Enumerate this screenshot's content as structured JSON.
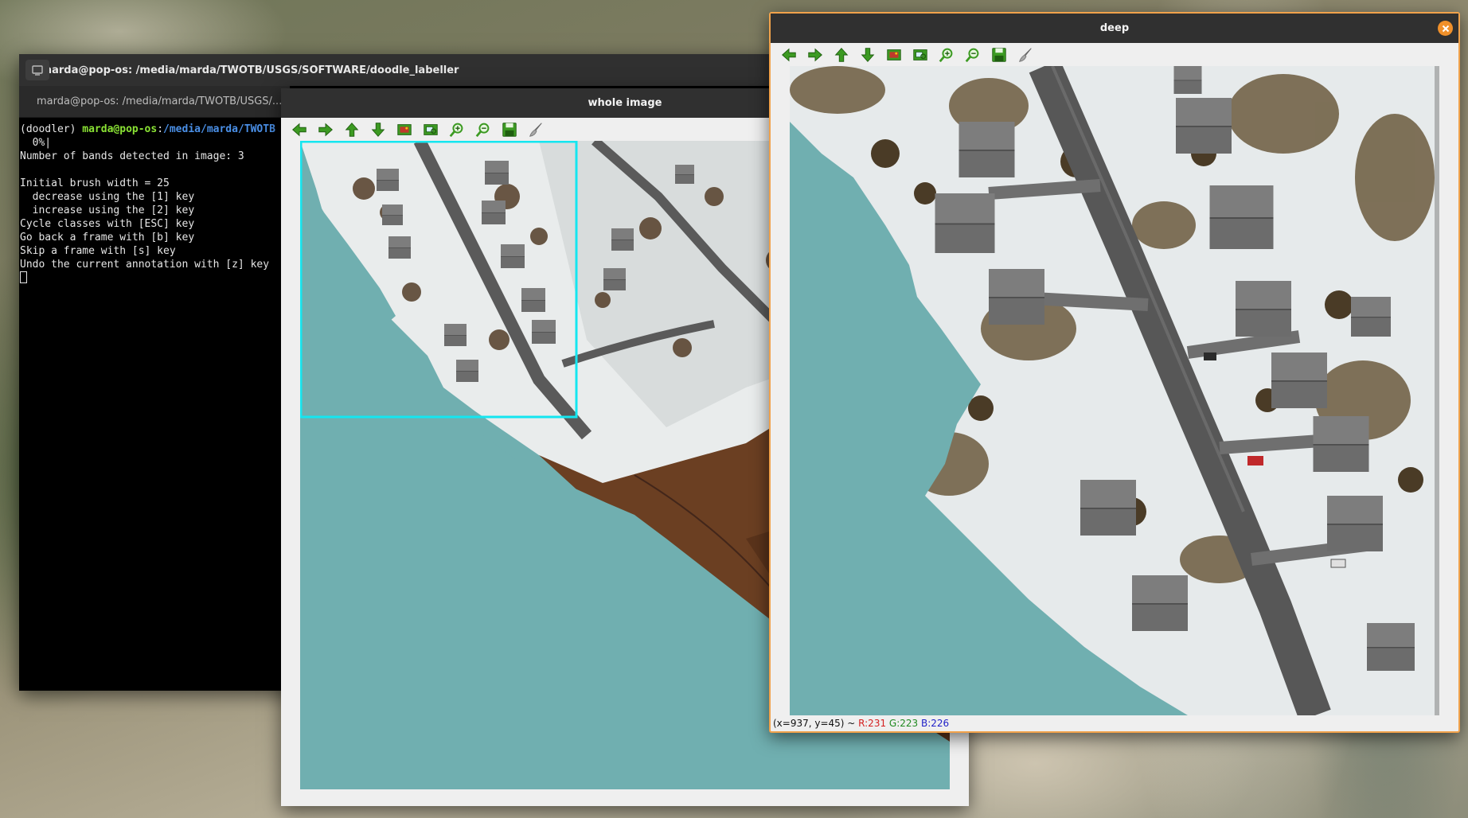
{
  "terminal": {
    "title": "marda@pop-os: /media/marda/TWOTB/USGS/SOFTWARE/doodle_labeller",
    "tab_label": "marda@pop-os: /media/marda/TWOTB/USGS/...",
    "prompt_env": "(doodler) ",
    "prompt_user": "marda@pop-os",
    "prompt_sep": ":",
    "prompt_path": "/media/marda/TWOTB",
    "lines": [
      "  0%|",
      "Number of bands detected in image: 3",
      "",
      "Initial brush width = 25",
      "  decrease using the [1] key",
      "  increase using the [2] key",
      "Cycle classes with [ESC] key",
      "Go back a frame with [b] key",
      "Skip a frame with [s] key",
      "Undo the current annotation with [z] key"
    ]
  },
  "whole_image_window": {
    "title": "whole image"
  },
  "deep_window": {
    "title": "deep",
    "status": {
      "coords": "(x=937, y=45) ~ ",
      "r": "R:231",
      "g": "G:223",
      "b": "B:226"
    }
  },
  "toolbar_icons": [
    "back-arrow-icon",
    "forward-arrow-icon",
    "up-arrow-icon",
    "down-arrow-icon",
    "image-icon",
    "zoom-rect-icon",
    "zoom-in-icon",
    "zoom-out-icon",
    "save-icon",
    "brush-icon"
  ],
  "colors": {
    "mask_teal": "#70afb0",
    "selection_cyan": "#14e6f0",
    "window_accent": "#f1a24b",
    "toolbar_green": "#3c9a22"
  }
}
